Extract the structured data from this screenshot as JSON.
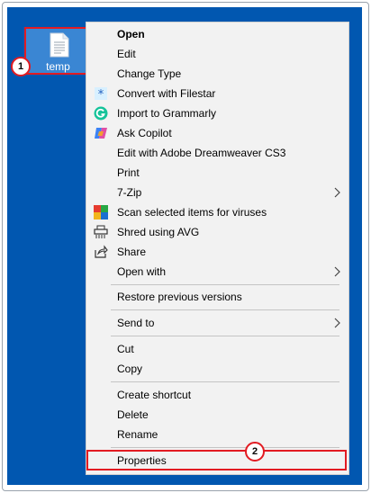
{
  "desktop": {
    "file": {
      "name": "temp",
      "icon": "text-document-icon"
    },
    "badges": [
      "1",
      "2"
    ]
  },
  "menu": {
    "items": [
      {
        "label": "Open",
        "bold": true,
        "icon": ""
      },
      {
        "label": "Edit",
        "icon": ""
      },
      {
        "label": "Change Type",
        "icon": ""
      },
      {
        "label": "Convert with Filestar",
        "icon": "filestar-icon"
      },
      {
        "label": "Import to Grammarly",
        "icon": "grammarly-icon"
      },
      {
        "label": "Ask Copilot",
        "icon": "copilot-icon"
      },
      {
        "label": "Edit with Adobe Dreamweaver CS3",
        "icon": ""
      },
      {
        "label": "Print",
        "icon": ""
      },
      {
        "label": "7-Zip",
        "icon": "",
        "submenu": true
      },
      {
        "label": "Scan selected items for viruses",
        "icon": "avg-icon"
      },
      {
        "label": "Shred using AVG",
        "icon": "shredder-icon"
      },
      {
        "label": "Share",
        "icon": "share-icon"
      },
      {
        "label": "Open with",
        "icon": "",
        "submenu": true
      },
      {
        "label": "Restore previous versions",
        "icon": ""
      },
      {
        "label": "Send to",
        "icon": "",
        "submenu": true
      },
      {
        "label": "Cut",
        "icon": ""
      },
      {
        "label": "Copy",
        "icon": ""
      },
      {
        "label": "Create shortcut",
        "icon": ""
      },
      {
        "label": "Delete",
        "icon": ""
      },
      {
        "label": "Rename",
        "icon": ""
      },
      {
        "label": "Properties",
        "icon": ""
      }
    ]
  },
  "colors": {
    "desktop": "#0157b0",
    "menu_bg": "#f2f2f2",
    "annotation": "#e21b22"
  }
}
